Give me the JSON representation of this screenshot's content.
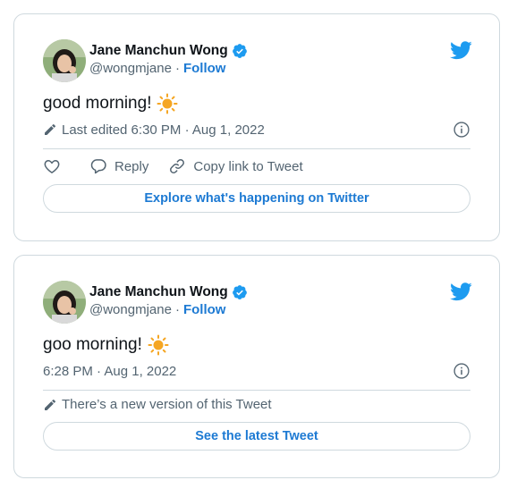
{
  "tweets": [
    {
      "author_name": "Jane Manchun Wong",
      "handle": "@wongmjane",
      "separator": "·",
      "follow_label": "Follow",
      "text": "good morning!",
      "meta": "Last edited 6:30 PM · Aug 1, 2022",
      "actions": {
        "reply_label": "Reply",
        "copy_label": "Copy link to Tweet"
      },
      "button_label": "Explore what's happening on Twitter"
    },
    {
      "author_name": "Jane Manchun Wong",
      "handle": "@wongmjane",
      "separator": "·",
      "follow_label": "Follow",
      "text": "goo morning!",
      "meta": "6:28 PM · Aug 1, 2022",
      "notice": "There’s a new version of this Tweet",
      "button_label": "See the latest Tweet"
    }
  ],
  "colors": {
    "accent": "#1d7ad3",
    "twitter_blue": "#1d9bf0",
    "muted": "#536471",
    "border": "#cfd9de",
    "sun": "#f5a623"
  },
  "icons": [
    "avatar",
    "verified-badge-icon",
    "twitter-bird-icon",
    "sun-emoji-icon",
    "pencil-icon",
    "info-icon",
    "heart-icon",
    "reply-icon",
    "link-icon"
  ]
}
